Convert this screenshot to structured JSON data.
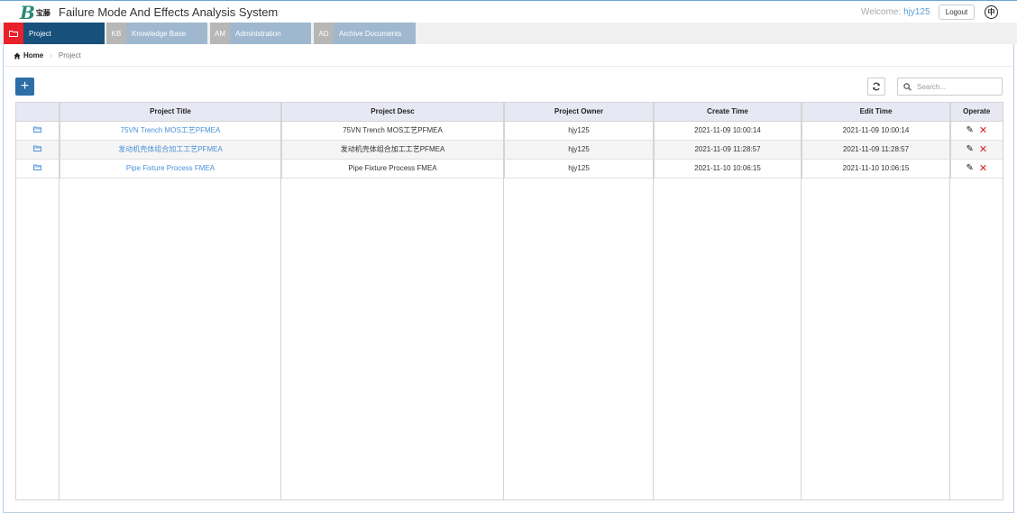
{
  "header": {
    "logo_text": "宝藤",
    "app_title": "Failure Mode And Effects Analysis System",
    "welcome_label": "Welcome: ",
    "username": "hjy125",
    "logout_label": "Logout",
    "lang_glyph": "中"
  },
  "tabs": [
    {
      "abbr": "",
      "label": "Project",
      "active": true
    },
    {
      "abbr": "KB",
      "label": "Knowledge Base",
      "active": false
    },
    {
      "abbr": "AM",
      "label": "Administration",
      "active": false
    },
    {
      "abbr": "AD",
      "label": "Archive Documents",
      "active": false
    }
  ],
  "breadcrumb": {
    "home": "Home",
    "current": "Project"
  },
  "toolbar": {
    "add_label": "+",
    "search_placeholder": "Search..."
  },
  "table": {
    "columns": [
      "",
      "Project Title",
      "Project Desc",
      "Project Owner",
      "Create Time",
      "Edit Time",
      "Operate"
    ],
    "rows": [
      {
        "title": "75VN Trench MOS工艺PFMEA",
        "desc": "75VN Trench MOS工艺PFMEA",
        "owner": "hjy125",
        "create": "2021-11-09 10:00:14",
        "edit": "2021-11-09 10:00:14"
      },
      {
        "title": "发动机壳体组合加工工艺PFMEA",
        "desc": "发动机壳体组合加工工艺PFMEA",
        "owner": "hjy125",
        "create": "2021-11-09 11:28:57",
        "edit": "2021-11-09 11:28:57"
      },
      {
        "title": "Pipe Fixture Process FMEA",
        "desc": "Pipe Fixture Process FMEA",
        "owner": "hjy125",
        "create": "2021-11-10 10:06:15",
        "edit": "2021-11-10 10:06:15"
      }
    ]
  },
  "icons": {
    "folder": "folder-icon",
    "edit": "pencil-icon",
    "delete": "close-icon",
    "refresh": "refresh-icon",
    "search": "search-icon",
    "home": "home-icon"
  },
  "colors": {
    "active_tab": "#16507b",
    "active_tab_badge": "#e8212b",
    "inactive_tab": "#9fb8cf",
    "link": "#4a90d9",
    "add_button": "#2b6ea8",
    "delete": "#d81e1e"
  }
}
